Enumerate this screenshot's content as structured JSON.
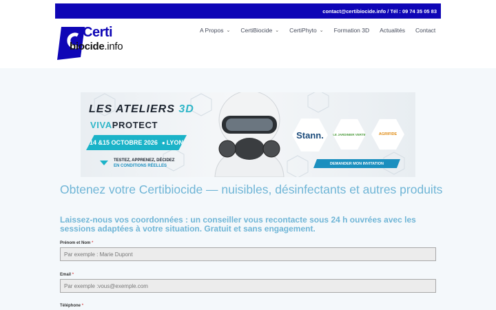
{
  "topbar": {
    "contact": "contact@certibiocide.info / Tél : 09 74 35 05 83"
  },
  "logo": {
    "certi": "Certi",
    "biocide": "biocide",
    "tld": ".info"
  },
  "nav": {
    "items": [
      {
        "label": "A Propos",
        "dropdown": true
      },
      {
        "label": "CertiBiocide",
        "dropdown": true
      },
      {
        "label": "CertiPhyto",
        "dropdown": true
      },
      {
        "label": "Formation 3D",
        "dropdown": false
      },
      {
        "label": "Actualités",
        "dropdown": false
      },
      {
        "label": "Contact",
        "dropdown": false
      }
    ],
    "chevron": "⌄"
  },
  "banner": {
    "title_part1": "LES ATELIERS",
    "title_part2": "3D",
    "subtitle_part1": "VIVA",
    "subtitle_part2": "PROTECT",
    "date": "14 &15 OCTOBRE 2026",
    "city": "LYON",
    "tagline_line1": "TESTEZ, APPRENEZ, DÉCIDEZ",
    "tagline_line2": "EN CONDITIONS RÉELLES",
    "partner1": "Stann.",
    "partner2": "LE JARDINIER VERTE",
    "partner3": "AGRIFIDE",
    "invite": "DEMANDER MON INVITATION",
    "accent_color": "#1bb3c8"
  },
  "main": {
    "heading": "Obtenez votre Certibiocide — nuisibles, désinfectants et autres produits",
    "subheading": "Laissez-nous vos coordonnées : un conseiller vous recontacte sous 24 h ouvrées avec les sessions adaptées à votre situation. Gratuit et sans engagement."
  },
  "form": {
    "name_label": "Prénom et Nom",
    "name_placeholder": "Par exemple : Marie Dupont",
    "email_label": "Email",
    "email_placeholder": "Par exemple :vous@exemple.com",
    "phone_label": "Téléphone",
    "required_mark": "*"
  },
  "colors": {
    "brand_blue": "#0f06b6",
    "heading_blue": "#6fb5d6"
  }
}
